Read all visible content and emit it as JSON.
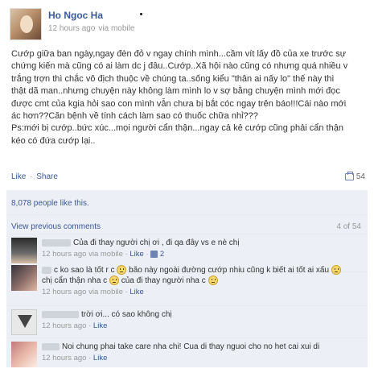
{
  "post": {
    "author": "Ho Ngoc Ha",
    "time": "12 hours ago",
    "via": "via mobile",
    "content_lines": [
      "Cướp giữa ban ngày,ngay đèn đỏ v ngay chính mình...cầm vít lấy đồ của xe trước sự",
      "chứng kiến mà cũng có ai làm dc j đâu..Cướp..Xã hội nào cũng có nhưng quá nhiều v",
      "trắng trợn thì chắc vô địch thuộc về chúng ta..sống kiểu \"thân ai nấy lo\" thế này thì",
      "thật dã man..nhưng chuyện này không làm mình lo v sợ bằng chuyện mình mới đọc",
      "được cmt của kgia hỏi sao con mình vẫn chưa bị bắt cóc ngay trên báo!!!Cái nào mới",
      "ác hơn??Căn bệnh về tính cách làm sao có thuốc chữa nhỉ???",
      "Ps:mới bị cướp..bức xúc...mọi người cẩn thận...ngay cả kẻ cướp cũng phải cẩn thận",
      "kéo có đứa cướp lại.."
    ]
  },
  "actions": {
    "like": "Like",
    "sep": "·",
    "share": "Share",
    "share_count": "54"
  },
  "likes_text": "8,078 people like this.",
  "comments_header": {
    "prev": "View previous comments",
    "count": "4 of 54"
  },
  "comments": [
    {
      "text": "Của đi thay người chị ơi , đi qa đây vs e nè chị",
      "time": "12 hours ago",
      "via": "via mobile",
      "like": "Like",
      "likes": "2"
    },
    {
      "text_1": "c ko sao là tốt r c",
      "text_2": "bão này ngoài đường cướp nhiu cũng k biết ai tốt ai xấu",
      "text_3": "chị cẩn thận nha c",
      "text_4": "của đi thay người nha c",
      "time": "12 hours ago",
      "via": "via mobile",
      "like": "Like"
    },
    {
      "text": "trời ơi... có sao không chị",
      "time": "12 hours ago",
      "like": "Like"
    },
    {
      "text": "Noi chung phai take care nha chi! Cua di thay nguoi cho no het cai xui di",
      "time": "12 hours ago",
      "like": "Like"
    }
  ],
  "icons": {
    "mobile": "mobile-icon",
    "share": "share-icon",
    "smile": "smile-emoticon",
    "thumb": "thumb-up-icon"
  },
  "colors": {
    "link": "#3b5998",
    "ufi_bg": "#eceff5",
    "muted": "#999999"
  }
}
